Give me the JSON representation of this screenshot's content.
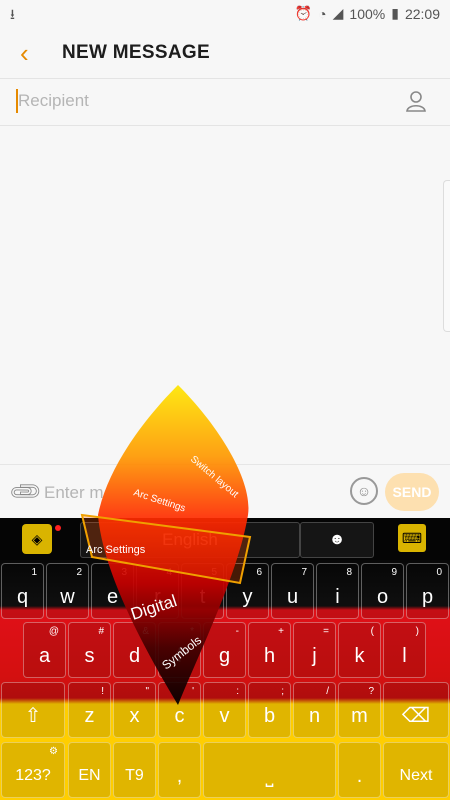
{
  "status": {
    "battery": "100%",
    "time": "22:09"
  },
  "header": {
    "title": "NEW MESSAGE",
    "back_icon": "chevron-left-icon"
  },
  "recipient": {
    "placeholder": "Recipient"
  },
  "composer": {
    "placeholder": "Enter m",
    "send_label": "SEND"
  },
  "keyboard": {
    "language": "English",
    "colors": {
      "black": "#000000",
      "red": "#dd0000",
      "gold": "#ffce00"
    },
    "row1": [
      {
        "k": "q",
        "h": "1"
      },
      {
        "k": "w",
        "h": "2"
      },
      {
        "k": "e",
        "h": "3"
      },
      {
        "k": "r",
        "h": "4"
      },
      {
        "k": "t",
        "h": "5"
      },
      {
        "k": "y",
        "h": "6"
      },
      {
        "k": "u",
        "h": "7"
      },
      {
        "k": "i",
        "h": "8"
      },
      {
        "k": "o",
        "h": "9"
      },
      {
        "k": "p",
        "h": "0"
      }
    ],
    "row2": [
      {
        "k": "a",
        "h": "@"
      },
      {
        "k": "s",
        "h": "#"
      },
      {
        "k": "d",
        "h": "&"
      },
      {
        "k": "f",
        "h": "*"
      },
      {
        "k": "g",
        "h": "-"
      },
      {
        "k": "h",
        "h": "+"
      },
      {
        "k": "j",
        "h": "="
      },
      {
        "k": "k",
        "h": "("
      },
      {
        "k": "l",
        "h": ")"
      }
    ],
    "row3": [
      {
        "k": "z",
        "h": "!"
      },
      {
        "k": "x",
        "h": "\""
      },
      {
        "k": "c",
        "h": "'"
      },
      {
        "k": "v",
        "h": ":"
      },
      {
        "k": "b",
        "h": ";"
      },
      {
        "k": "n",
        "h": "/"
      },
      {
        "k": "m",
        "h": "?"
      }
    ],
    "bottom": {
      "sym": "123?",
      "en": "EN",
      "t9": "T9",
      "comma": ",",
      "period": ".",
      "next": "Next"
    }
  },
  "arc_menu": {
    "items": [
      "Switch layout",
      "Arc Settings",
      "Arc Settings",
      "Digital",
      "Symbols"
    ]
  }
}
